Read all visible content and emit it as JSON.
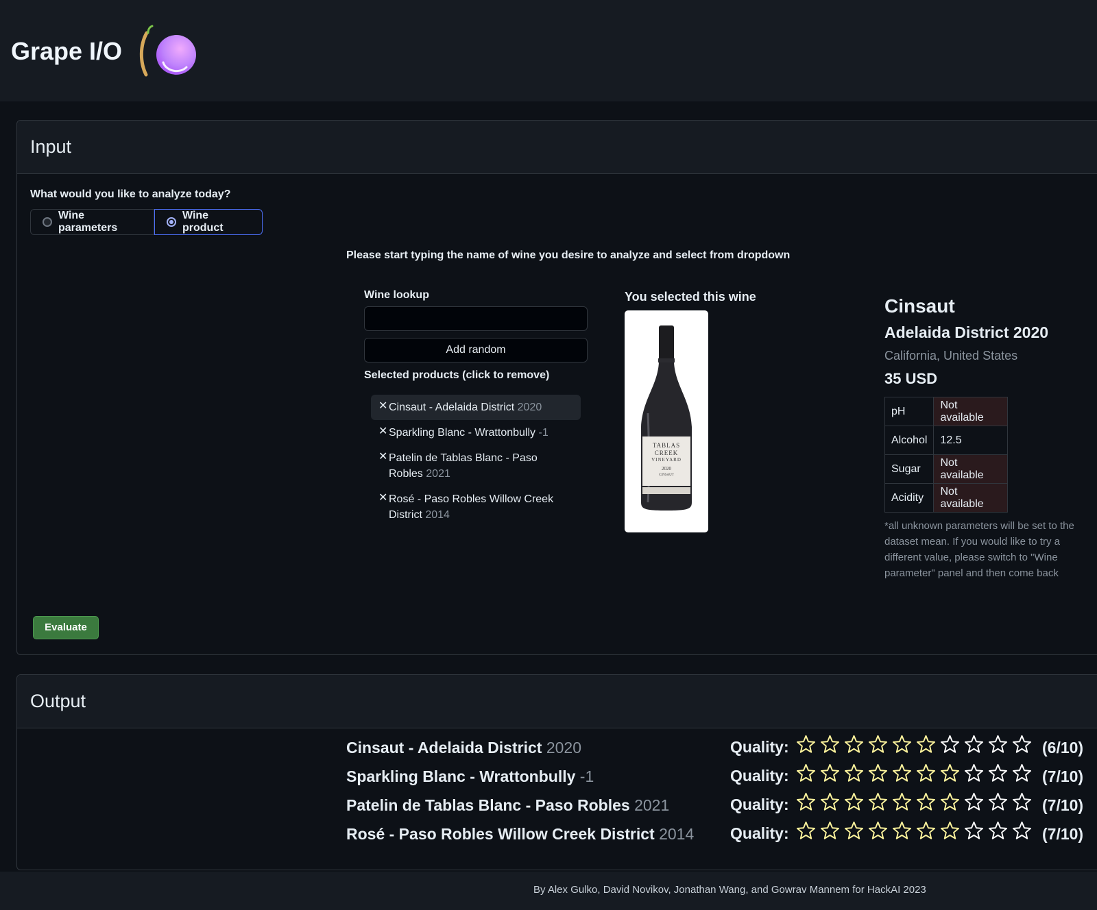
{
  "app": {
    "title": "Grape I/O"
  },
  "input": {
    "title": "Input",
    "question": "What would you like to analyze today?",
    "options": [
      "Wine parameters",
      "Wine product"
    ],
    "selected_option": "Wine product",
    "hint": "Please start typing the name of wine you desire to analyze and select from dropdown",
    "lookup_label": "Wine lookup",
    "lookup_value": "",
    "add_random_label": "Add random",
    "selected_label": "Selected products (click to remove)",
    "products": [
      {
        "name": "Cinsaut - Adelaida District",
        "year": "2020"
      },
      {
        "name": "Sparkling Blanc - Wrattonbully",
        "year": "-1"
      },
      {
        "name": "Patelin de Tablas Blanc - Paso Robles",
        "year": "2021"
      },
      {
        "name": "Rosé - Paso Robles Willow Creek District",
        "year": "2014"
      }
    ],
    "you_selected_label": "You selected this wine",
    "wine": {
      "name": "Cinsaut",
      "vintage": "Adelaida District 2020",
      "region": "California, United States",
      "price": "35 USD",
      "params": [
        {
          "key": "pH",
          "value": "Not available"
        },
        {
          "key": "Alcohol",
          "value": "12.5"
        },
        {
          "key": "Sugar",
          "value": "Not available"
        },
        {
          "key": "Acidity",
          "value": "Not available"
        }
      ],
      "note": "*all unknown parameters will be set to the dataset mean. If you would like to try a different value, please switch to \"Wine parameter\" panel and then come back"
    },
    "evaluate_label": "Evaluate"
  },
  "output": {
    "title": "Output",
    "quality_label": "Quality:",
    "results": [
      {
        "name": "Cinsaut - Adelaida District",
        "year": "2020",
        "score": 6,
        "score_text": "(6/10)"
      },
      {
        "name": "Sparkling Blanc - Wrattonbully",
        "year": "-1",
        "score": 7,
        "score_text": "(7/10)"
      },
      {
        "name": "Patelin de Tablas Blanc - Paso Robles",
        "year": "2021",
        "score": 7,
        "score_text": "(7/10)"
      },
      {
        "name": "Rosé - Paso Robles Willow Creek District",
        "year": "2014",
        "score": 7,
        "score_text": "(7/10)"
      }
    ],
    "max_score": 10
  },
  "footer": {
    "text": "By Alex Gulko, David Novikov, Jonathan Wang, and Gowrav Mannem for HackAI 2023"
  },
  "colors": {
    "background": "#0d1117",
    "panel": "#161b22",
    "accent": "#a5b4fc",
    "evaluate": "#3b7a3e",
    "star_fill": "#fff59d"
  }
}
